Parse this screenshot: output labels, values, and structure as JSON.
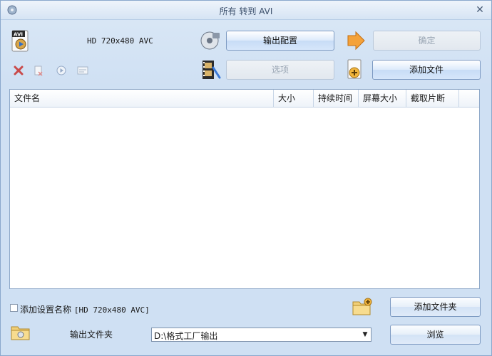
{
  "window": {
    "title": "所有 转到 AVI"
  },
  "profile": {
    "label": "HD 720x480 AVC"
  },
  "buttons": {
    "output_config": "输出配置",
    "ok": "确定",
    "options": "选项",
    "add_file": "添加文件",
    "add_folder": "添加文件夹",
    "browse": "浏览"
  },
  "table": {
    "columns": [
      "文件名",
      "大小",
      "持续时间",
      "屏幕大小",
      "截取片断"
    ],
    "rows": []
  },
  "settings": {
    "add_name_label": "添加设置名称",
    "add_name_value": "[HD 720x480 AVC]",
    "add_name_checked": false
  },
  "output": {
    "folder_label": "输出文件夹",
    "folder_value": "D:\\格式工厂输出"
  },
  "icons": {
    "app": "app-icon",
    "close": "close-icon",
    "avi": "avi-file-icon",
    "output_config": "disc-config-icon",
    "arrow": "arrow-right-icon",
    "film": "film-icon",
    "add_file": "add-file-icon",
    "remove": "remove-icon",
    "clear": "clear-icon",
    "play": "play-icon",
    "info": "info-icon",
    "add_folder": "add-folder-icon",
    "folder": "folder-icon"
  }
}
